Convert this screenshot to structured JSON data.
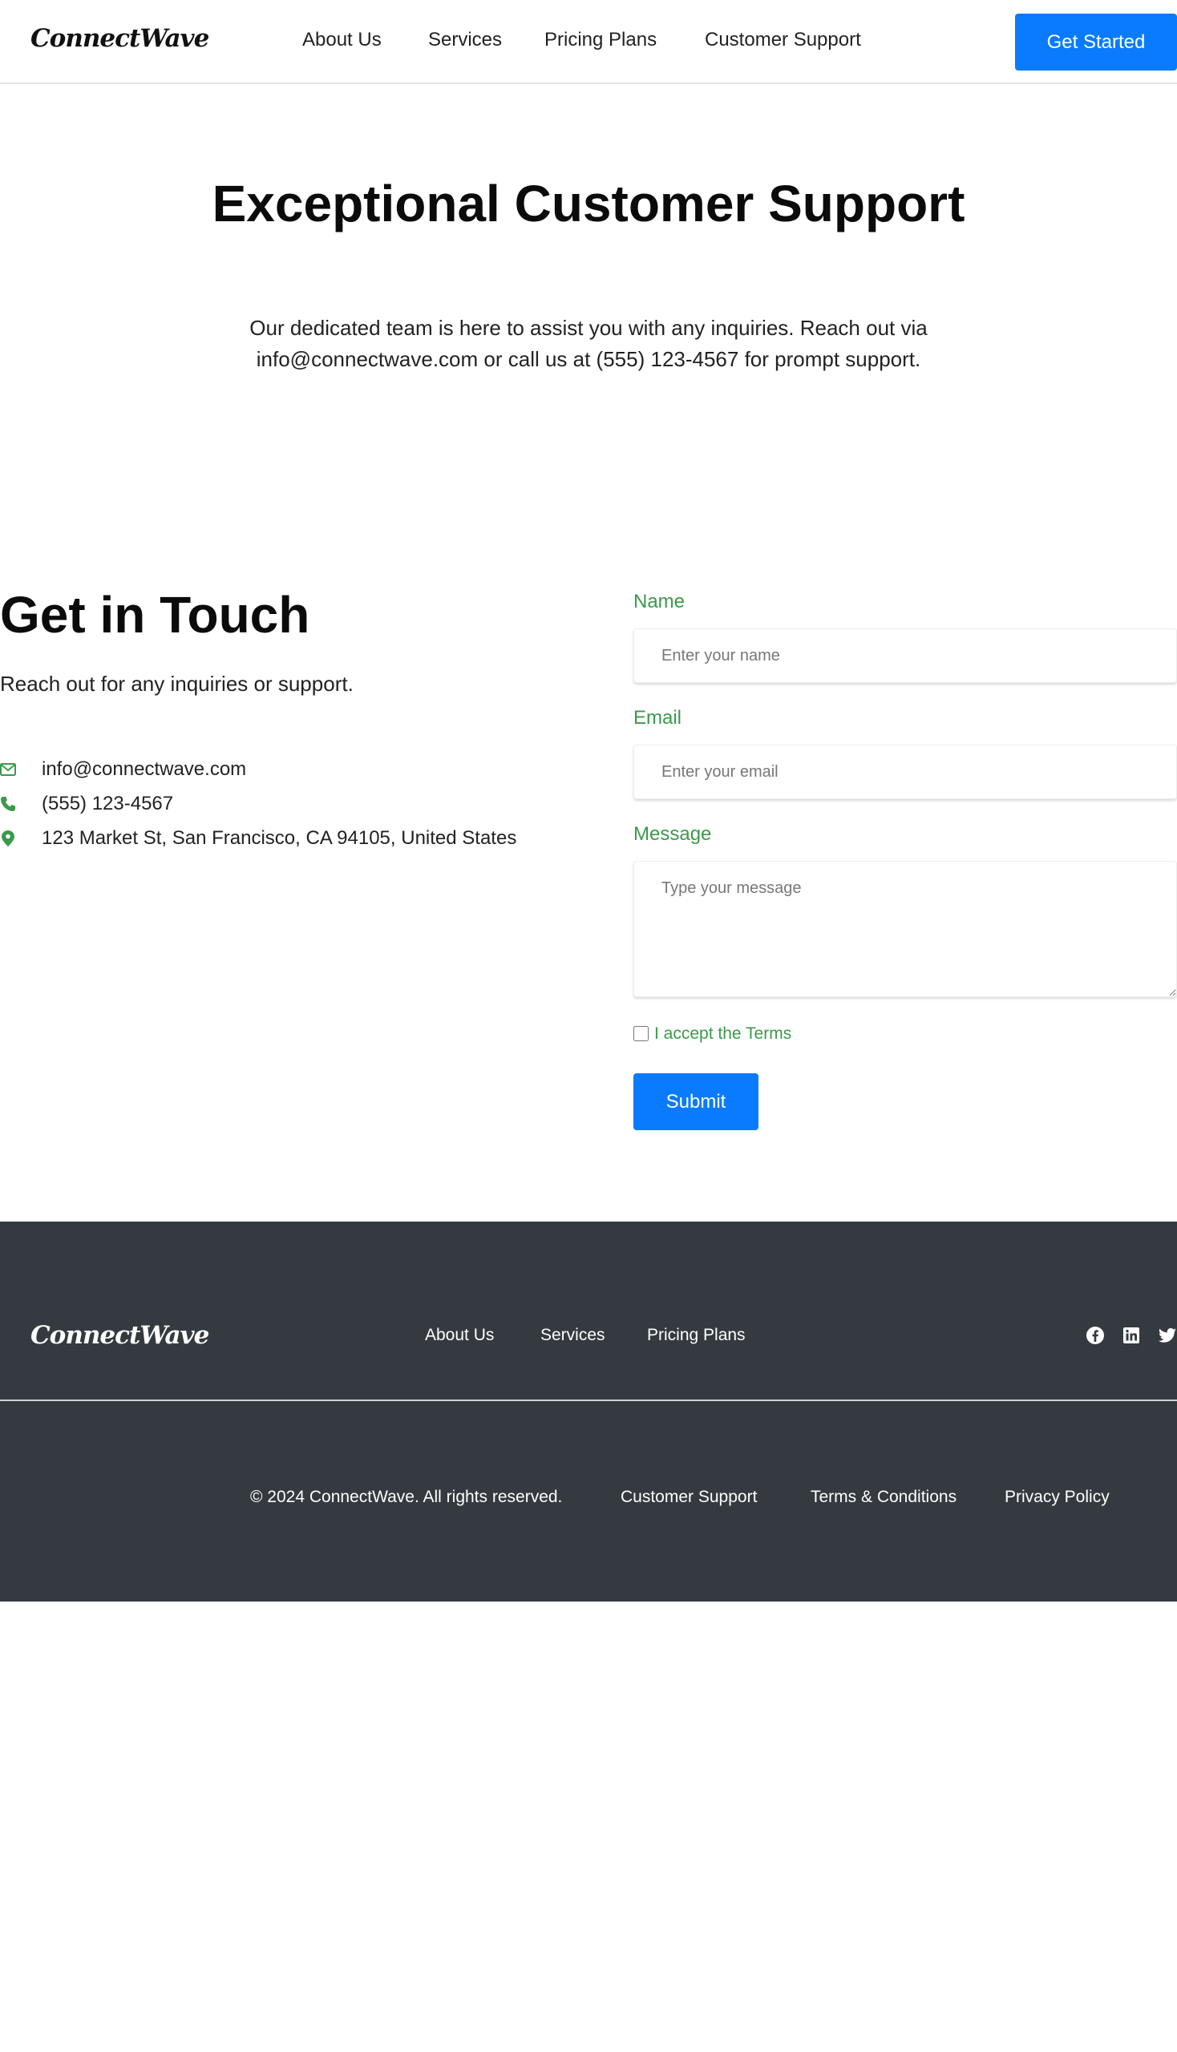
{
  "header": {
    "logo": "ConnectWave",
    "nav": [
      "About Us",
      "Services",
      "Pricing Plans",
      "Customer Support"
    ],
    "cta_label": "Get Started"
  },
  "hero": {
    "title": "Exceptional Customer Support",
    "text": "Our dedicated team is here to assist you with any inquiries. Reach out via info@connectwave.com or call us at (555) 123-4567 for prompt support."
  },
  "contact": {
    "title": "Get in Touch",
    "subtitle": "Reach out for any inquiries or support.",
    "items": [
      {
        "icon": "envelope-icon",
        "text": "info@connectwave.com"
      },
      {
        "icon": "phone-icon",
        "text": "(555) 123-4567"
      },
      {
        "icon": "map-pin-icon",
        "text": "123 Market St, San Francisco, CA 94105, United States"
      }
    ]
  },
  "form": {
    "name_label": "Name",
    "name_placeholder": "Enter your name",
    "email_label": "Email",
    "email_placeholder": "Enter your email",
    "message_label": "Message",
    "message_placeholder": "Type your message",
    "terms_label": "I accept the Terms",
    "submit_label": "Submit"
  },
  "footer": {
    "logo": "ConnectWave",
    "nav": [
      "About Us",
      "Services",
      "Pricing Plans"
    ],
    "social": [
      "facebook-icon",
      "linkedin-icon",
      "twitter-icon"
    ],
    "copyright": "© 2024 ConnectWave. All rights reserved.",
    "links": [
      "Customer Support",
      "Terms & Conditions",
      "Privacy Policy"
    ]
  },
  "colors": {
    "accent": "#0a7bff",
    "label_green": "#3a9a4a",
    "footer_bg": "#343a40"
  }
}
